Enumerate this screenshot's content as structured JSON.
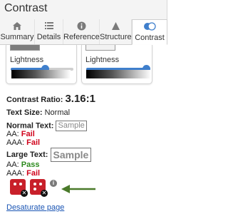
{
  "header": {
    "title": "Contrast"
  },
  "tabs": [
    {
      "label": "Summary",
      "icon": "home-icon"
    },
    {
      "label": "Details",
      "icon": "list-icon"
    },
    {
      "label": "Reference",
      "icon": "info-icon"
    },
    {
      "label": "Structure",
      "icon": "structure-icon"
    },
    {
      "label": "Contrast",
      "icon": "contrast-icon",
      "active": true
    }
  ],
  "foreground": {
    "lightness_label": "Lightness",
    "lightness_level": 0.55
  },
  "background": {
    "lightness_label": "Lightness",
    "lightness_level": 0.95
  },
  "results": {
    "ratio_label": "Contrast Ratio:",
    "ratio_value": "3.16:1",
    "text_size_label": "Text Size:",
    "text_size_value": "Normal",
    "normal_text_label": "Normal Text:",
    "normal_sample": "Sample",
    "normal_aa_label": "AA:",
    "normal_aa_value": "Fail",
    "normal_aaa_label": "AAA:",
    "normal_aaa_value": "Fail",
    "large_text_label": "Large Text:",
    "large_sample": "Sample",
    "large_aa_label": "AA:",
    "large_aa_value": "Pass",
    "large_aaa_label": "AAA:",
    "large_aaa_value": "Fail"
  },
  "actions": {
    "desaturate_link": "Desaturate page"
  },
  "colors": {
    "accent": "#3f7fcc",
    "fail": "#d0021b",
    "pass": "#2e8b1f",
    "toggle": "#c8202a",
    "arrow": "#4a7a2a",
    "link": "#1a55b4"
  }
}
